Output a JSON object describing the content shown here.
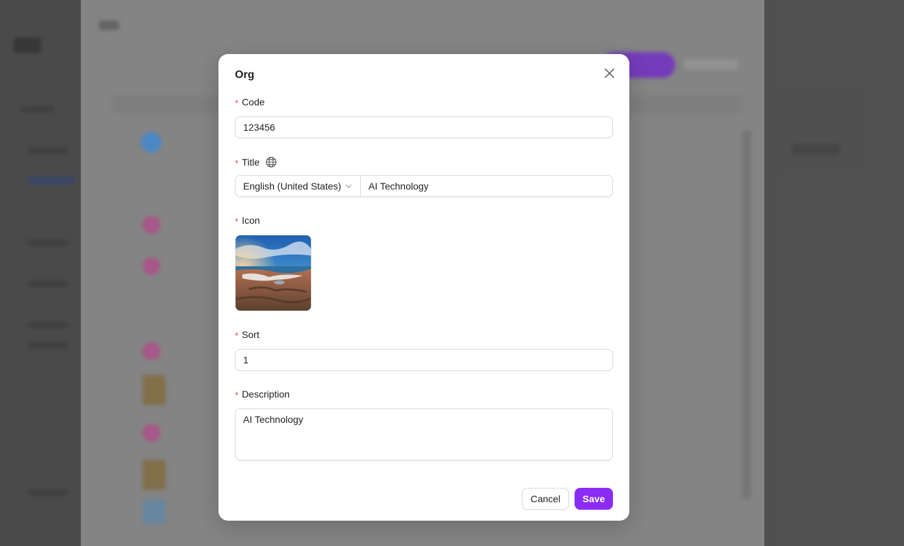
{
  "modal": {
    "title": "Org",
    "close_icon": "close-icon",
    "fields": {
      "code": {
        "label": "Code",
        "value": "123456"
      },
      "title": {
        "label": "Title",
        "language": "English (United States)",
        "value": "AI Technology",
        "globe_icon": "globe-icon"
      },
      "icon": {
        "label": "Icon"
      },
      "sort": {
        "label": "Sort",
        "value": "1"
      },
      "description": {
        "label": "Description",
        "value": "AI Technology"
      }
    },
    "required_mark": "*",
    "actions": {
      "cancel_label": "Cancel",
      "save_label": "Save"
    }
  },
  "colors": {
    "accent": "#8b2cf5",
    "required": "#e5484d"
  }
}
